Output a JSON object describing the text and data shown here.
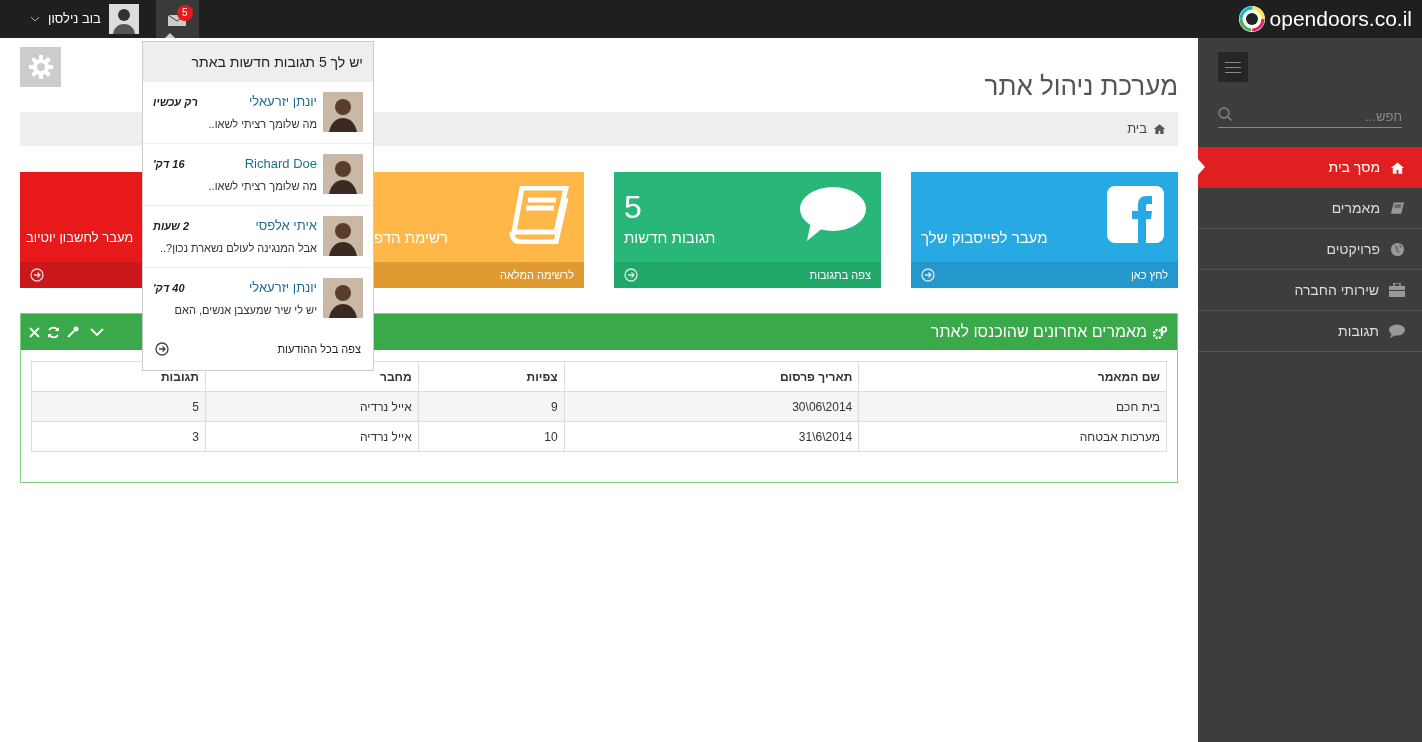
{
  "topbar": {
    "logo": "opendoors.co.il",
    "user": {
      "name": "בוב נילסון"
    },
    "notifications": {
      "count": "5"
    }
  },
  "sidebar": {
    "search": {
      "placeholder": "חפש..."
    },
    "items": [
      {
        "label": "מסך בית",
        "selected": true
      },
      {
        "label": "מאמרים",
        "selected": false
      },
      {
        "label": "פרויקטים",
        "selected": false
      },
      {
        "label": "שירותי החברה",
        "selected": false
      },
      {
        "label": "תגובות",
        "selected": false
      }
    ]
  },
  "page": {
    "title": "מערכת ניהול אתר",
    "breadcrumb": [
      "בית"
    ]
  },
  "tiles": [
    {
      "title": "מעבר לפייסבוק שלך",
      "footer": "לחץ כאן",
      "color": "#27a9e3"
    },
    {
      "value": "5",
      "title": "תגובות חדשות",
      "footer": "צפה בתגובות",
      "color": "#28b779"
    },
    {
      "title": "רשימת הדפ",
      "footer": "לרשימה המלאה",
      "color": "#ffb848"
    },
    {
      "title": "מעבר לחשבון יוטיוב",
      "color": "#e7191b"
    }
  ],
  "widget": {
    "title": "מאמרים אחרונים שהוכנסו לאתר",
    "table": {
      "columns": [
        "שם המאמר",
        "תאריך פרסום",
        "צפיות",
        "מחבר",
        "תגובות"
      ],
      "rows": [
        [
          "בית חכם",
          "2014\\06\\30",
          "9",
          "אייל נרדיה",
          "5"
        ],
        [
          "מערכות אבטחה",
          "2014\\6\\31",
          "10",
          "אייל נרדיה",
          "3"
        ]
      ]
    }
  },
  "notifications_menu": {
    "header": "יש לך 5 תגובות חדשות באתר",
    "items": [
      {
        "name": "יונתן יזרעאלי",
        "time": "רק עכשיו",
        "message": "מה שלומך רציתי לשאו.."
      },
      {
        "name": "Richard Doe",
        "time": "16 דק'",
        "message": "מה שלומך רציתי לשאו.."
      },
      {
        "name": "איתי אלפסי",
        "time": "2 שעות",
        "message": "אבל המנגינה לעולם נשארת נכון?.."
      },
      {
        "name": "יונתן יזרעאלי",
        "time": "40 דק'",
        "message": "יש לי שיר שמעצבן אנשים, האם"
      }
    ],
    "footer": "צפה בכל ההודעות"
  }
}
